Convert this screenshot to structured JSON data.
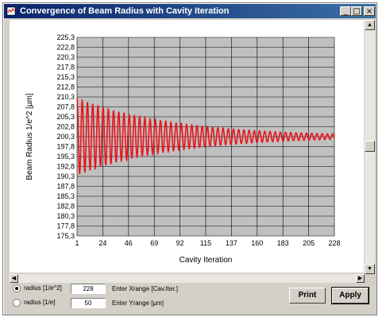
{
  "window": {
    "title": "Convergence of Beam Radius with Cavity Iteration",
    "buttons": {
      "minimize": "_",
      "maximize": "□",
      "close": "×"
    }
  },
  "chart_data": {
    "type": "line",
    "xlabel": "Cavity Iteration",
    "ylabel": "Beam Radius 1/e^2  [µm]",
    "xlim": [
      1,
      228
    ],
    "ylim": [
      175.3,
      225.3
    ],
    "x_ticks": [
      "1",
      "24",
      "46",
      "69",
      "92",
      "115",
      "137",
      "160",
      "183",
      "205",
      "228"
    ],
    "y_ticks": [
      "225,3",
      "222,8",
      "220,3",
      "217,8",
      "215,3",
      "212,8",
      "210,3",
      "207,8",
      "205,3",
      "202,8",
      "200,3",
      "197,8",
      "195,3",
      "192,8",
      "190,3",
      "187,8",
      "185,3",
      "182,8",
      "180,3",
      "177,8",
      "175,3"
    ],
    "grid": true,
    "series": [
      {
        "color": "#e8141a",
        "model": "damped oscillation",
        "center": 200.3,
        "initial_amplitude": 9.7,
        "decay_per_iteration": 0.0118,
        "period_iterations": 4.6,
        "iterations": 228
      }
    ]
  },
  "controls": {
    "radio_1": {
      "label": "radius [1/e^2]",
      "selected": true
    },
    "radio_2": {
      "label": "radius [1/e]",
      "selected": false
    },
    "xrange_value": "228",
    "xrange_label": "Enter Xrange [Cav.Iter.]",
    "yrange_value": "50",
    "yrange_label": "Enter Yrange [µm]",
    "print_label": "Print",
    "apply_label": "Apply"
  },
  "colors": {
    "titlebar_start": "#0a246a",
    "titlebar_end": "#3a6ea5",
    "plot_background": "#c0c0c0",
    "series": "#e8141a"
  }
}
